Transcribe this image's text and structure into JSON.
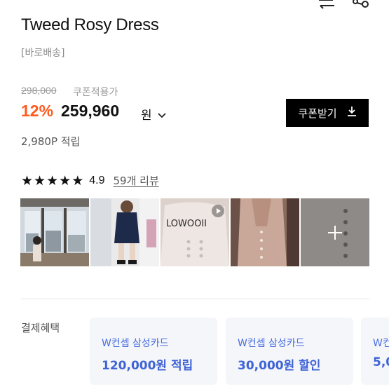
{
  "header": {
    "icons": [
      "swap-icon",
      "share-icon"
    ]
  },
  "product": {
    "title": "Tweed Rosy Dress",
    "shipping_tag": "[바로배송]",
    "original_price": "298,000",
    "coupon_note": "쿠폰적용가",
    "discount": "12%",
    "price": "259,960",
    "currency": "원",
    "points": "2,980P 적립"
  },
  "coupon_button": {
    "label": "쿠폰받기",
    "icon": "download-icon"
  },
  "rating": {
    "stars": 5,
    "score": "4.9",
    "review_link": "59개 리뷰"
  },
  "gallery": {
    "thumbs": [
      "window-photo",
      "navy-dress-photo",
      "video-thumbnail",
      "dress-detail-photo",
      "more-photos"
    ],
    "video_text": "LOWOOII"
  },
  "benefits": {
    "label": "결제혜택",
    "cards": [
      {
        "name": "W컨셉 삼성카드",
        "amount": "120,000원 적립"
      },
      {
        "name": "W컨셉 삼성카드",
        "amount": "30,000원 할인"
      },
      {
        "name": "W컨",
        "amount": "5,0"
      }
    ]
  },
  "colors": {
    "discount": "#ff5a1f",
    "accent_blue": "#3f63d6",
    "button_bg": "#000000"
  }
}
